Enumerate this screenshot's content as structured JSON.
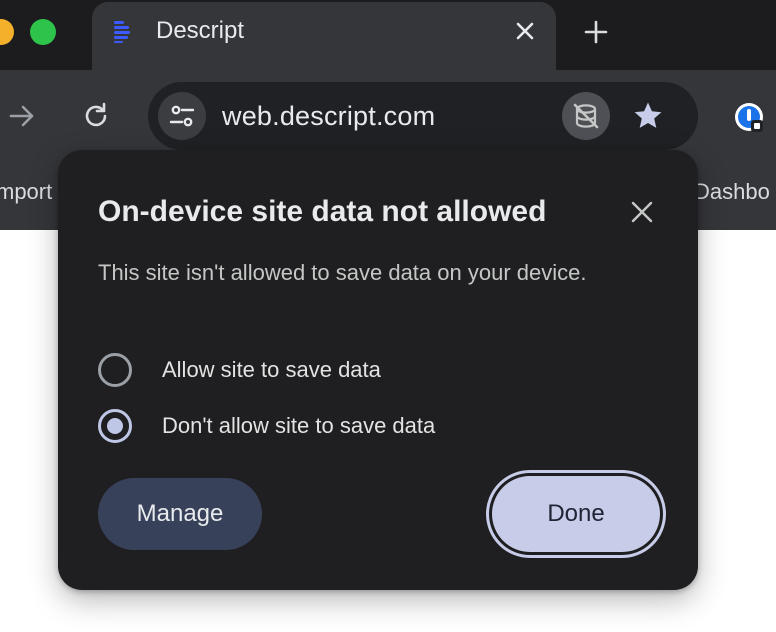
{
  "colors": {
    "tabstrip": "#1c1c1f",
    "toolbar": "#35363a",
    "popup_bg": "#1f1f21",
    "manage_bg": "#38415a",
    "done_bg": "#c7cde8",
    "radio_checked": "#bfc7e6",
    "descript_blue": "#3b5bfe"
  },
  "browser": {
    "tab": {
      "title": "Descript",
      "logo_icon": "descript-logo-icon",
      "close_icon": "close-icon"
    },
    "new_tab_icon": "plus-icon",
    "toolbar": {
      "forward_icon": "arrow-right-icon",
      "reload_icon": "reload-icon",
      "site_settings_icon": "tune-icon",
      "url": "web.descript.com",
      "data_blocked_icon": "database-off-icon",
      "bookmark_icon": "star-icon",
      "extension_icon": "extension-icon"
    },
    "bookmarks": {
      "left_partial": "mport",
      "right_partial": "Dashbo"
    }
  },
  "popup": {
    "title": "On-device site data not allowed",
    "description": "This site isn't allowed to save data on your device.",
    "options": [
      {
        "label": "Allow site to save data",
        "checked": false
      },
      {
        "label": "Don't allow site to save data",
        "checked": true
      }
    ],
    "manage_label": "Manage",
    "done_label": "Done"
  }
}
